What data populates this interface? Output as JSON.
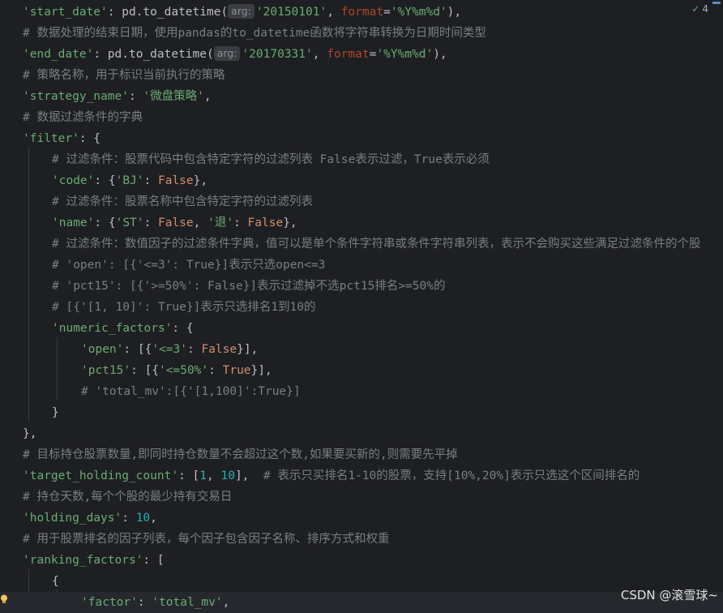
{
  "editor": {
    "inspection_count": "4",
    "watermark": "CSDN @滚雪球~",
    "lines": [
      {
        "indent": 0,
        "tokens": [
          {
            "t": "s",
            "v": "'start_date'"
          },
          {
            "t": "p",
            "v": ": pd.to_datetime("
          },
          {
            "t": "h",
            "v": "arg:"
          },
          {
            "t": "s",
            "v": "'20150101'"
          },
          {
            "t": "p",
            "v": ", "
          },
          {
            "t": "kw",
            "v": "format"
          },
          {
            "t": "p",
            "v": "="
          },
          {
            "t": "s",
            "v": "'%Y%m%d'"
          },
          {
            "t": "p",
            "v": "),"
          }
        ]
      },
      {
        "indent": 0,
        "tokens": [
          {
            "t": "c",
            "v": "# 数据处理的结束日期，使用pandas的to_datetime函数将字符串转换为日期时间类型"
          }
        ]
      },
      {
        "indent": 0,
        "tokens": [
          {
            "t": "s",
            "v": "'end_date'"
          },
          {
            "t": "p",
            "v": ": pd.to_datetime("
          },
          {
            "t": "h",
            "v": "arg:"
          },
          {
            "t": "s",
            "v": "'20170331'"
          },
          {
            "t": "p",
            "v": ", "
          },
          {
            "t": "kw",
            "v": "format"
          },
          {
            "t": "p",
            "v": "="
          },
          {
            "t": "s",
            "v": "'%Y%m%d'"
          },
          {
            "t": "p",
            "v": "),"
          }
        ]
      },
      {
        "indent": 0,
        "tokens": [
          {
            "t": "c",
            "v": "# 策略名称，用于标识当前执行的策略"
          }
        ]
      },
      {
        "indent": 0,
        "tokens": [
          {
            "t": "s",
            "v": "'strategy_name'"
          },
          {
            "t": "p",
            "v": ": "
          },
          {
            "t": "s",
            "v": "'微盘策略'"
          },
          {
            "t": "p",
            "v": ","
          }
        ]
      },
      {
        "indent": 0,
        "tokens": [
          {
            "t": "c",
            "v": "# 数据过滤条件的字典"
          }
        ]
      },
      {
        "indent": 0,
        "tokens": [
          {
            "t": "s",
            "v": "'filter'"
          },
          {
            "t": "p",
            "v": ": {"
          }
        ]
      },
      {
        "indent": 1,
        "tokens": [
          {
            "t": "c",
            "v": "# 过滤条件：股票代码中包含特定字符的过滤列表 False表示过滤，True表示必须"
          }
        ]
      },
      {
        "indent": 1,
        "tokens": [
          {
            "t": "s",
            "v": "'code'"
          },
          {
            "t": "p",
            "v": ": {"
          },
          {
            "t": "s",
            "v": "'BJ'"
          },
          {
            "t": "p",
            "v": ": "
          },
          {
            "t": "k",
            "v": "False"
          },
          {
            "t": "p",
            "v": "},"
          }
        ]
      },
      {
        "indent": 1,
        "tokens": [
          {
            "t": "c",
            "v": "# 过滤条件：股票名称中包含特定字符的过滤列表"
          }
        ]
      },
      {
        "indent": 1,
        "tokens": [
          {
            "t": "s",
            "v": "'name'"
          },
          {
            "t": "p",
            "v": ": {"
          },
          {
            "t": "s",
            "v": "'ST'"
          },
          {
            "t": "p",
            "v": ": "
          },
          {
            "t": "k",
            "v": "False"
          },
          {
            "t": "p",
            "v": ", "
          },
          {
            "t": "s",
            "v": "'退'"
          },
          {
            "t": "p",
            "v": ": "
          },
          {
            "t": "k",
            "v": "False"
          },
          {
            "t": "p",
            "v": "},"
          }
        ]
      },
      {
        "indent": 1,
        "tokens": [
          {
            "t": "c",
            "v": "# 过滤条件：数值因子的过滤条件字典，值可以是单个条件字符串或条件字符串列表，表示不会购买这些满足过滤条件的个股"
          }
        ]
      },
      {
        "indent": 1,
        "tokens": [
          {
            "t": "c",
            "v": "# 'open': [{'<=3': True}]表示只选open<=3"
          }
        ]
      },
      {
        "indent": 1,
        "tokens": [
          {
            "t": "c",
            "v": "# 'pct15': [{'>=50%': False}]表示过滤掉不选pct15排名>=50%的"
          }
        ]
      },
      {
        "indent": 1,
        "tokens": [
          {
            "t": "c",
            "v": "# [{'[1, 10]': True}]表示只选排名1到10的"
          }
        ]
      },
      {
        "indent": 1,
        "tokens": [
          {
            "t": "s",
            "v": "'numeric_factors'"
          },
          {
            "t": "p",
            "v": ": {"
          }
        ]
      },
      {
        "indent": 2,
        "tokens": [
          {
            "t": "s",
            "v": "'open'"
          },
          {
            "t": "p",
            "v": ": [{"
          },
          {
            "t": "s",
            "v": "'<=3'"
          },
          {
            "t": "p",
            "v": ": "
          },
          {
            "t": "k",
            "v": "False"
          },
          {
            "t": "p",
            "v": "}],"
          }
        ]
      },
      {
        "indent": 2,
        "tokens": [
          {
            "t": "s",
            "v": "'pct15'"
          },
          {
            "t": "p",
            "v": ": [{"
          },
          {
            "t": "s",
            "v": "'<=50%'"
          },
          {
            "t": "p",
            "v": ": "
          },
          {
            "t": "k",
            "v": "True"
          },
          {
            "t": "p",
            "v": "}],"
          }
        ]
      },
      {
        "indent": 2,
        "tokens": [
          {
            "t": "c",
            "v": "# 'total_mv':[{'[1,100]':True}]"
          }
        ]
      },
      {
        "indent": 1,
        "tokens": [
          {
            "t": "p",
            "v": "}"
          }
        ]
      },
      {
        "indent": 0,
        "tokens": [
          {
            "t": "p",
            "v": "},"
          }
        ]
      },
      {
        "indent": 0,
        "tokens": [
          {
            "t": "c",
            "v": "# 目标持仓股票数量,即同时持仓数量不会超过这个数,如果要买新的,则需要先平掉"
          }
        ]
      },
      {
        "indent": 0,
        "tokens": [
          {
            "t": "s",
            "v": "'target_holding_count'"
          },
          {
            "t": "p",
            "v": ": ["
          },
          {
            "t": "n",
            "v": "1"
          },
          {
            "t": "p",
            "v": ", "
          },
          {
            "t": "n",
            "v": "10"
          },
          {
            "t": "p",
            "v": "],  "
          },
          {
            "t": "c",
            "v": "# 表示只买排名1-10的股票，支持[10%,20%]表示只选这个区间排名的"
          }
        ]
      },
      {
        "indent": 0,
        "tokens": [
          {
            "t": "c",
            "v": "# 持仓天数,每个个股的最少持有交易日"
          }
        ]
      },
      {
        "indent": 0,
        "tokens": [
          {
            "t": "s",
            "v": "'holding_days'"
          },
          {
            "t": "p",
            "v": ": "
          },
          {
            "t": "n",
            "v": "10"
          },
          {
            "t": "p",
            "v": ","
          }
        ]
      },
      {
        "indent": 0,
        "tokens": [
          {
            "t": "c",
            "v": "# 用于股票排名的因子列表，每个因子包含因子名称、排序方式和权重"
          }
        ]
      },
      {
        "indent": 0,
        "tokens": [
          {
            "t": "s",
            "v": "'ranking_factors'"
          },
          {
            "t": "p",
            "v": ": ["
          }
        ]
      },
      {
        "indent": 1,
        "tokens": [
          {
            "t": "p",
            "v": "{"
          }
        ]
      },
      {
        "indent": 2,
        "current": true,
        "tokens": [
          {
            "t": "s",
            "v": "'factor'"
          },
          {
            "t": "p",
            "v": ": "
          },
          {
            "t": "s",
            "v": "'total_mv'"
          },
          {
            "t": "p",
            "v": ","
          }
        ]
      }
    ]
  }
}
